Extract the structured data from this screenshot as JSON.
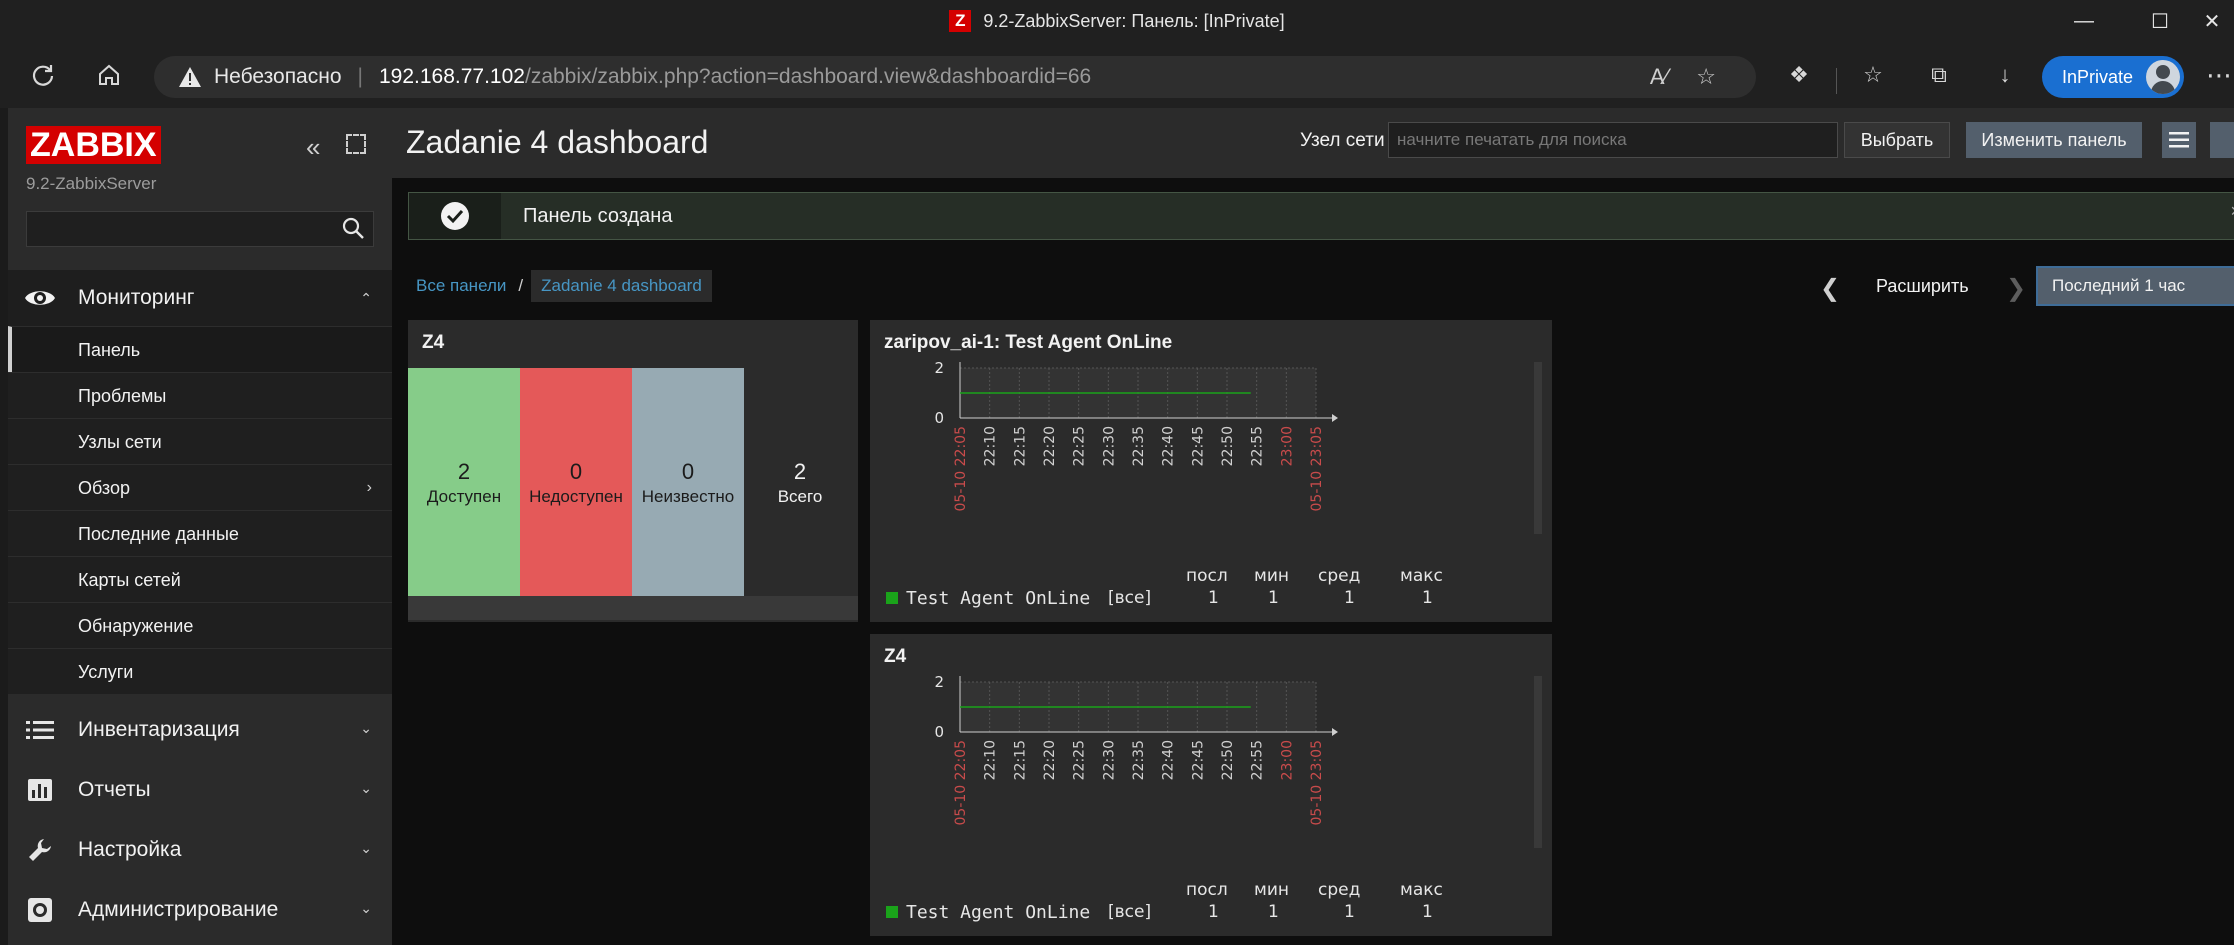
{
  "browser": {
    "title": "9.2-ZabbixServer: Панель: [InPrivate]",
    "favicon_letter": "Z",
    "insecure_label": "Небезопасно",
    "url_host": "192.168.77.102",
    "url_path": "/zabbix/zabbix.php?action=dashboard.view&dashboardid=66",
    "inprivate_label": "InPrivate"
  },
  "sidebar": {
    "logo": "ZABBIX",
    "server_name": "9.2-ZabbixServer",
    "search_placeholder": "",
    "monitoring": {
      "label": "Мониторинг",
      "items": [
        {
          "label": "Панель",
          "active": true
        },
        {
          "label": "Проблемы"
        },
        {
          "label": "Узлы сети"
        },
        {
          "label": "Обзор",
          "has_submenu": true
        },
        {
          "label": "Последние данные"
        },
        {
          "label": "Карты сетей"
        },
        {
          "label": "Обнаружение"
        },
        {
          "label": "Услуги"
        }
      ]
    },
    "sections": [
      {
        "label": "Инвентаризация",
        "icon": "list-icon"
      },
      {
        "label": "Отчеты",
        "icon": "reports-icon"
      },
      {
        "label": "Настройка",
        "icon": "wrench-icon"
      },
      {
        "label": "Администрирование",
        "icon": "gear-icon"
      }
    ]
  },
  "header": {
    "title": "Zadanie 4 dashboard",
    "host_label": "Узел сети",
    "host_placeholder": "начните печатать для поиска",
    "select_button": "Выбрать",
    "edit_button": "Изменить панель"
  },
  "message": {
    "text": "Панель создана",
    "close": "×"
  },
  "breadcrumb": {
    "all": "Все панели",
    "current": "Zadanie 4 dashboard"
  },
  "timeframe": {
    "zoom_out": "Расширить",
    "period": "Последний 1 час"
  },
  "host_status_widget": {
    "title": "Z4",
    "cells": [
      {
        "value": "2",
        "label": "Доступен",
        "color": "#86cc89"
      },
      {
        "value": "0",
        "label": "Недоступен",
        "color": "#e45959"
      },
      {
        "value": "0",
        "label": "Неизвестно",
        "color": "#97aab3"
      },
      {
        "value": "2",
        "label": "Всего",
        "color": "#2b2b2b"
      }
    ]
  },
  "graph_widgets": [
    {
      "title": "zaripov_ai-1: Test Agent OnLine",
      "series_name": "Test Agent OnLine",
      "scope": "[все]",
      "legend_headers": [
        "посл",
        "мин",
        "сред",
        "макс"
      ],
      "legend_values": [
        "1",
        "1",
        "1",
        "1"
      ]
    },
    {
      "title": "Z4",
      "series_name": "Test Agent OnLine",
      "scope": "[все]",
      "legend_headers": [
        "посл",
        "мин",
        "сред",
        "макс"
      ],
      "legend_values": [
        "1",
        "1",
        "1",
        "1"
      ]
    }
  ],
  "chart_data": [
    {
      "type": "line",
      "title": "zaripov_ai-1: Test Agent OnLine",
      "x_tick_labels": [
        "05-10 22:05",
        "22:10",
        "22:15",
        "22:20",
        "22:25",
        "22:30",
        "22:35",
        "22:40",
        "22:45",
        "22:50",
        "22:55",
        "23:00",
        "05-10 23:05"
      ],
      "y_tick_labels": [
        "0",
        "2"
      ],
      "ylim": [
        0,
        2
      ],
      "series": [
        {
          "name": "Test Agent OnLine",
          "color": "#1aa31a",
          "x": [
            "22:05",
            "22:54"
          ],
          "y": [
            1,
            1
          ]
        }
      ],
      "grid": true
    },
    {
      "type": "line",
      "title": "Z4",
      "x_tick_labels": [
        "05-10 22:05",
        "22:10",
        "22:15",
        "22:20",
        "22:25",
        "22:30",
        "22:35",
        "22:40",
        "22:45",
        "22:50",
        "22:55",
        "23:00",
        "05-10 23:05"
      ],
      "y_tick_labels": [
        "0",
        "2"
      ],
      "ylim": [
        0,
        2
      ],
      "series": [
        {
          "name": "Test Agent OnLine",
          "color": "#1aa31a",
          "x": [
            "22:05",
            "22:54"
          ],
          "y": [
            1,
            1
          ]
        }
      ],
      "grid": true
    }
  ]
}
